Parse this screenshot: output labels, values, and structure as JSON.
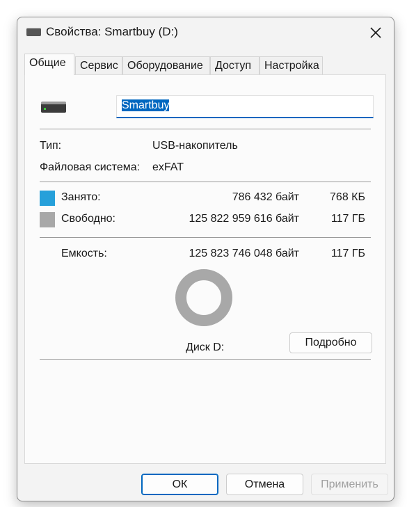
{
  "window": {
    "title": "Свойства: Smartbuy (D:)",
    "close_icon": "close-icon"
  },
  "tabs": [
    {
      "label": "Общие",
      "active": true
    },
    {
      "label": "Сервис",
      "active": false
    },
    {
      "label": "Оборудование",
      "active": false
    },
    {
      "label": "Доступ",
      "active": false
    },
    {
      "label": "Настройка",
      "active": false
    }
  ],
  "general": {
    "drive_icon": "usb-drive-icon",
    "name_value": "Smartbuy",
    "type_label": "Тип:",
    "type_value": "USB-накопитель",
    "fs_label": "Файловая система:",
    "fs_value": "exFAT",
    "used": {
      "label": "Занято:",
      "bytes": "786 432 байт",
      "size": "768 КБ",
      "color": "#26a0da"
    },
    "free": {
      "label": "Свободно:",
      "bytes": "125 822 959 616 байт",
      "size": "117 ГБ",
      "color": "#a8a8a8"
    },
    "capacity": {
      "label": "Емкость:",
      "bytes": "125 823 746 048 байт",
      "size": "117 ГБ"
    },
    "used_fraction": 6.25e-06,
    "disk_label": "Диск D:",
    "details_button": "Подробно"
  },
  "buttons": {
    "ok": "ОК",
    "cancel": "Отмена",
    "apply": "Применить"
  }
}
